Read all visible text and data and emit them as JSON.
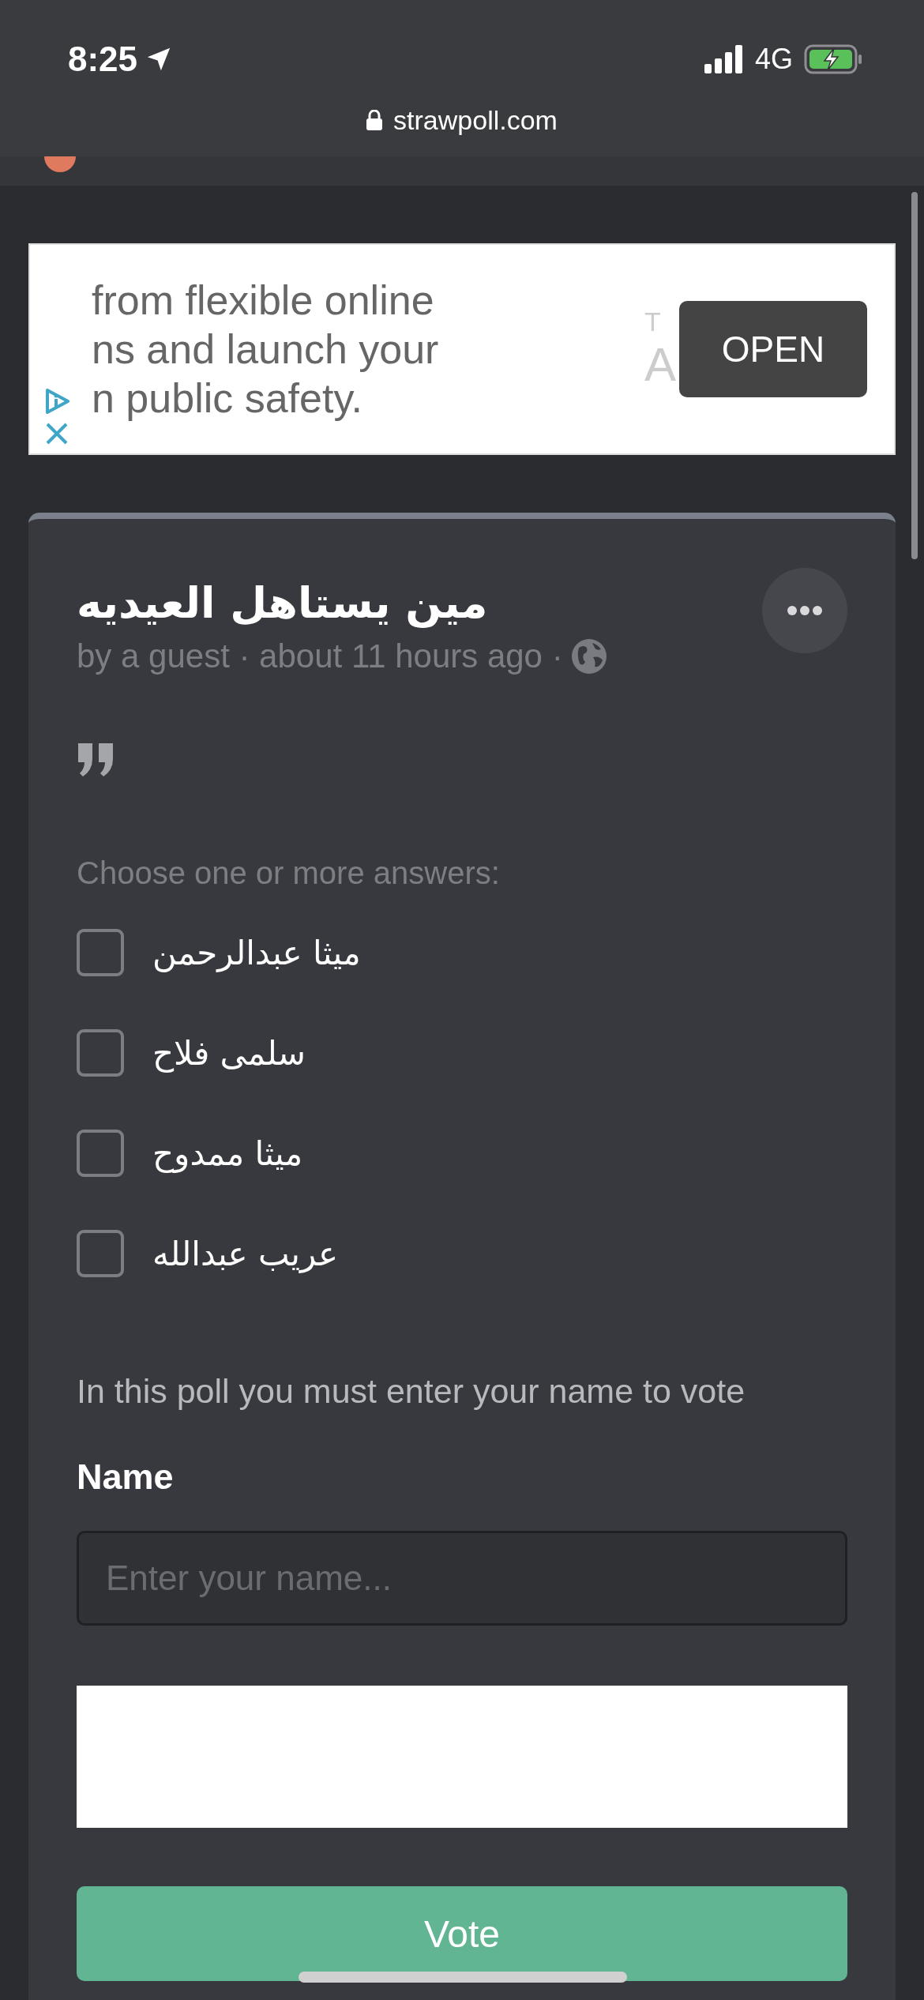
{
  "status_bar": {
    "time": "8:25",
    "network": "4G"
  },
  "browser": {
    "url": "strawpoll.com"
  },
  "ad": {
    "lines": [
      "from flexible online",
      "ns and launch your",
      "n public safety."
    ],
    "faint_texts": [
      "T",
      "A"
    ],
    "button": "OPEN"
  },
  "poll": {
    "title": "مين يستاهل العيديه",
    "meta": "by a guest · about 11 hours ago ·",
    "prompt": "Choose one or more answers:",
    "options": [
      {
        "label": "ميثا عبدالرحمن",
        "checked": false
      },
      {
        "label": "سلمى فلاح",
        "checked": false
      },
      {
        "label": "ميثا ممدوح",
        "checked": false
      },
      {
        "label": "عريب عبدالله",
        "checked": false
      }
    ],
    "name_notice": "In this poll you must enter your name to vote",
    "name_label": "Name",
    "name_field": {
      "placeholder": "Enter your name..."
    },
    "vote_button": "Vote"
  }
}
